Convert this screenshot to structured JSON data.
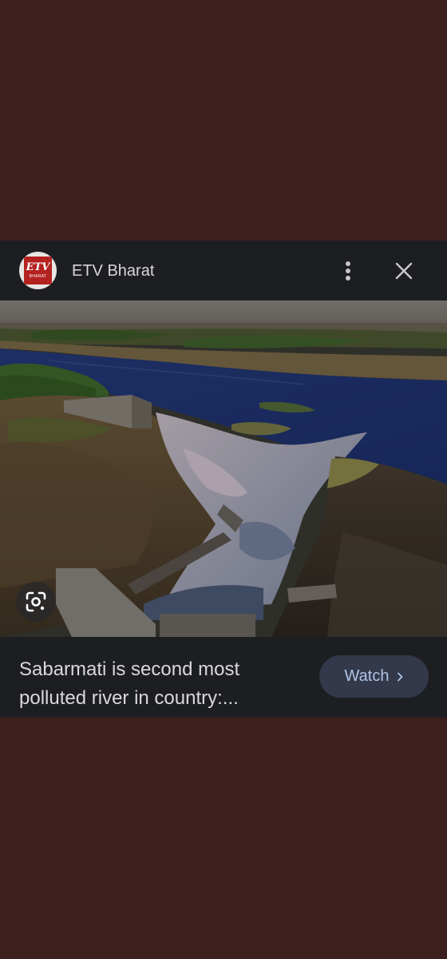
{
  "card": {
    "source": {
      "name": "ETV Bharat",
      "logo_text": "ETV",
      "logo_subtext": "BHARAT"
    },
    "header_icons": {
      "more": "more-vertical-icon",
      "close": "close-icon"
    },
    "image": {
      "lens_icon": "google-lens-icon"
    },
    "caption": {
      "line1": "Sabarmati is second most",
      "line2": "polluted river in country:..."
    },
    "watch_button": {
      "label": "Watch",
      "icon": "chevron-right-icon"
    }
  },
  "colors": {
    "page_background": "#3d1f1d",
    "card_background": "#1d1e22",
    "watch_button_bg": "#33394a",
    "watch_button_text": "#aec3e6",
    "logo_red": "#b3221f"
  }
}
